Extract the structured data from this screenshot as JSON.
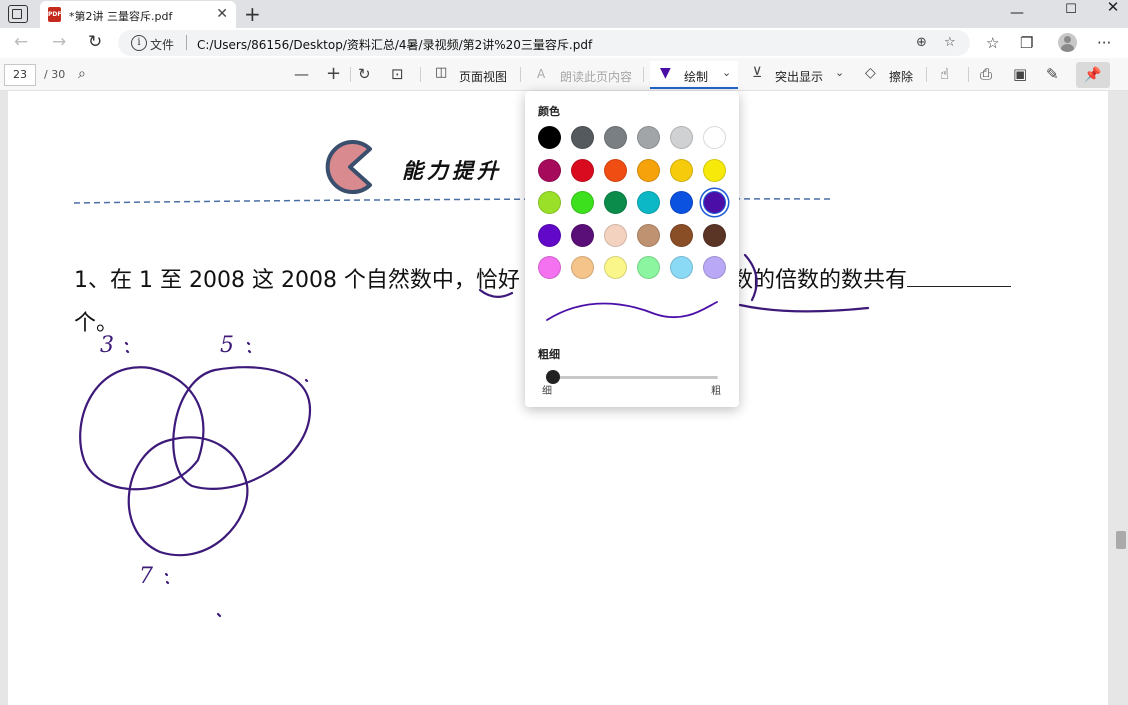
{
  "browser": {
    "tab_title": "*第2讲 三量容斥.pdf",
    "address_label": "文件",
    "url": "C:/Users/86156/Desktop/资料汇总/4暑/录视频/第2讲%20三量容斥.pdf"
  },
  "pdf_toolbar": {
    "current_page": "23",
    "total_pages": "/ 30",
    "page_view_label": "页面视图",
    "read_aloud_label": "朗读此页内容",
    "draw_label": "绘制",
    "highlight_label": "突出显示",
    "erase_label": "擦除"
  },
  "document": {
    "section_heading": "能力提升",
    "question_line1_start": "1、在 1 至 2008 这 2008 个自然数中，恰好",
    "question_line1_end": "数的倍数的数共有",
    "question_line2": "个。",
    "ink_labels": [
      "3",
      "5",
      "7"
    ]
  },
  "draw_popup": {
    "color_label": "颜色",
    "thickness_label": "粗细",
    "thin_label": "细",
    "thick_label": "粗",
    "thickness_value": 0.0,
    "selected_color": "#4b0fa8",
    "colors": [
      [
        "#000000",
        "#555a5e",
        "#7a7f83",
        "#a2a5a8",
        "#cfd1d3",
        "#ffffff"
      ],
      [
        "#a60a5a",
        "#d90b1f",
        "#f04d13",
        "#f5a20b",
        "#f5cb0b",
        "#f7ea0b"
      ],
      [
        "#9be028",
        "#3de01c",
        "#0b8c4a",
        "#0cb8c6",
        "#0b52e0",
        "#4b0fa8"
      ],
      [
        "#6208c8",
        "#5a0f78",
        "#f4d2c0",
        "#bf9371",
        "#8a4e27",
        "#5a3526"
      ],
      [
        "#f472f0",
        "#f5c48a",
        "#fbf68a",
        "#8cf5a0",
        "#8ad9f5",
        "#b9a8f5"
      ]
    ]
  },
  "ink_color": "#3d1a7a"
}
